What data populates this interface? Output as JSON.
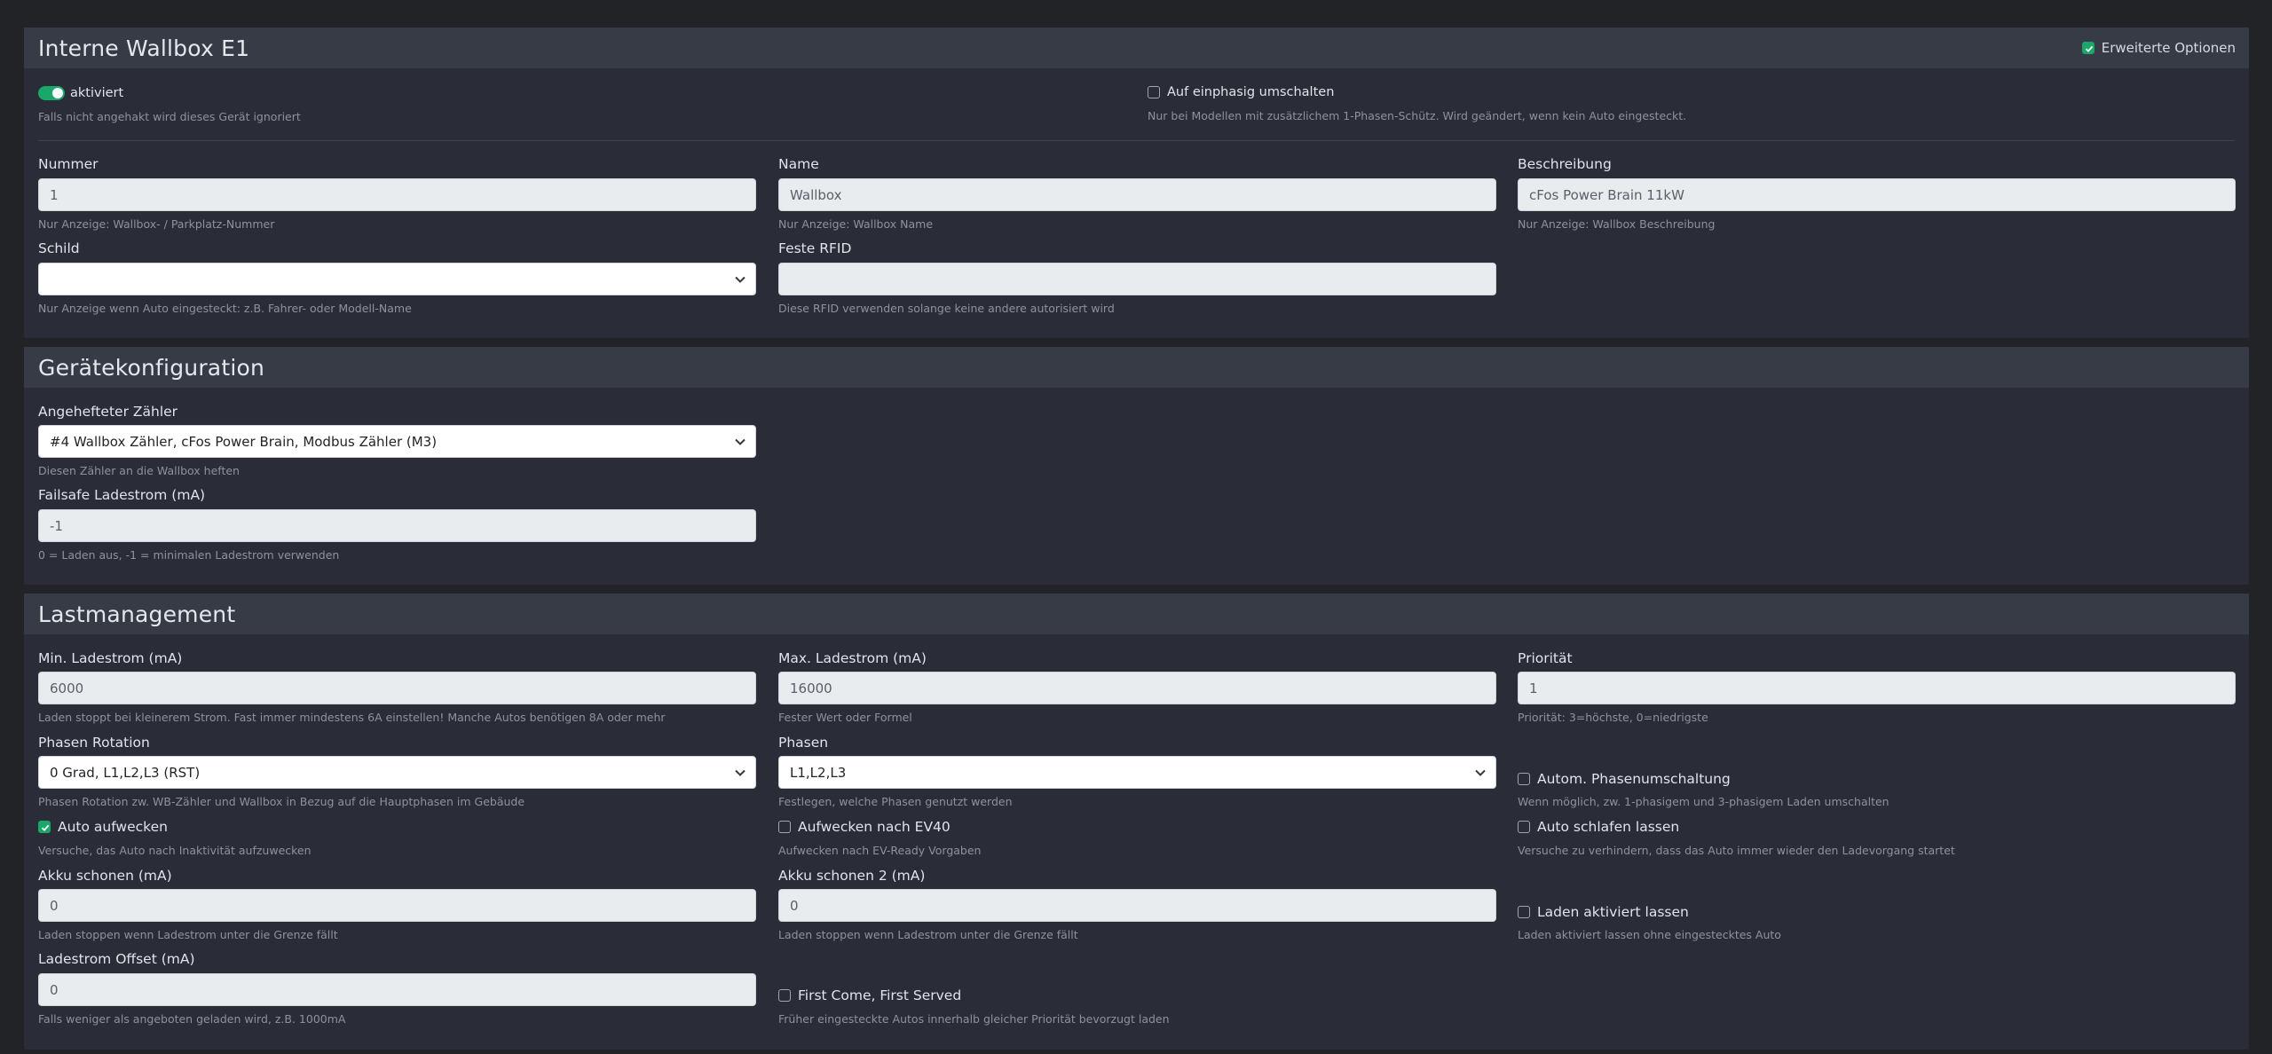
{
  "wallbox_card": {
    "title": "Interne Wallbox E1",
    "advanced_options_label": "Erweiterte Optionen",
    "advanced_options_checked": true,
    "enabled_label": "aktiviert",
    "enabled_hint": "Falls nicht angehakt wird dieses Gerät ignoriert",
    "single_phase_label": "Auf einphasig umschalten",
    "single_phase_hint": "Nur bei Modellen mit zusätzlichem 1-Phasen-Schütz. Wird geändert, wenn kein Auto eingesteckt.",
    "nummer_label": "Nummer",
    "nummer_value": "1",
    "nummer_hint": "Nur Anzeige: Wallbox- / Parkplatz-Nummer",
    "name_label": "Name",
    "name_value": "Wallbox",
    "name_hint": "Nur Anzeige: Wallbox Name",
    "beschreibung_label": "Beschreibung",
    "beschreibung_value": "cFos Power Brain 11kW",
    "beschreibung_hint": "Nur Anzeige: Wallbox Beschreibung",
    "schild_label": "Schild",
    "schild_value": "",
    "schild_hint": "Nur Anzeige wenn Auto eingesteckt: z.B. Fahrer- oder Modell-Name",
    "rfid_label": "Feste RFID",
    "rfid_value": "",
    "rfid_hint": "Diese RFID verwenden solange keine andere autorisiert wird"
  },
  "device_card": {
    "title": "Gerätekonfiguration",
    "meter_label": "Angehefteter Zähler",
    "meter_value": "#4 Wallbox Zähler, cFos Power Brain, Modbus Zähler (M3)",
    "meter_hint": "Diesen Zähler an die Wallbox heften",
    "failsafe_label": "Failsafe Ladestrom (mA)",
    "failsafe_value": "-1",
    "failsafe_hint": "0 = Laden aus, -1 = minimalen Ladestrom verwenden"
  },
  "load_card": {
    "title": "Lastmanagement",
    "min_label": "Min. Ladestrom (mA)",
    "min_value": "6000",
    "min_hint": "Laden stoppt bei kleinerem Strom. Fast immer mindestens 6A einstellen! Manche Autos benötigen 8A oder mehr",
    "max_label": "Max. Ladestrom (mA)",
    "max_value": "16000",
    "max_hint": "Fester Wert oder Formel",
    "prio_label": "Priorität",
    "prio_value": "1",
    "prio_hint": "Priorität: 3=höchste, 0=niedrigste",
    "rotation_label": "Phasen Rotation",
    "rotation_value": "0 Grad, L1,L2,L3 (RST)",
    "rotation_hint": "Phasen Rotation zw. WB-Zähler und Wallbox in Bezug auf die Hauptphasen im Gebäude",
    "phases_label": "Phasen",
    "phases_value": "L1,L2,L3",
    "phases_hint": "Festlegen, welche Phasen genutzt werden",
    "auto_switch_label": "Autom. Phasenumschaltung",
    "auto_switch_hint": "Wenn möglich, zw. 1-phasigem und 3-phasigem Laden umschalten",
    "wake_label": "Auto aufwecken",
    "wake_checked": true,
    "wake_hint": "Versuche, das Auto nach Inaktivität aufzuwecken",
    "wake_ev40_label": "Aufwecken nach EV40",
    "wake_ev40_hint": "Aufwecken nach EV-Ready Vorgaben",
    "sleep_label": "Auto schlafen lassen",
    "sleep_hint": "Versuche zu verhindern, dass das Auto immer wieder den Ladevorgang startet",
    "battery_label": "Akku schonen (mA)",
    "battery_value": "0",
    "battery_hint": "Laden stoppen wenn Ladestrom unter die Grenze fällt",
    "battery2_label": "Akku schonen 2 (mA)",
    "battery2_value": "0",
    "battery2_hint": "Laden stoppen wenn Ladestrom unter die Grenze fällt",
    "keep_label": "Laden aktiviert lassen",
    "keep_hint": "Laden aktiviert lassen ohne eingestecktes Auto",
    "offset_label": "Ladestrom Offset (mA)",
    "offset_value": "0",
    "offset_hint": "Falls weniger als angeboten geladen wird, z.B. 1000mA",
    "fcfs_label": "First Come, First Served",
    "fcfs_hint": "Früher eingesteckte Autos innerhalb gleicher Priorität bevorzugt laden"
  },
  "colors": {
    "background": "#212327",
    "card": "#2a2c38",
    "header": "#363b46",
    "accent": "#19a86a"
  }
}
